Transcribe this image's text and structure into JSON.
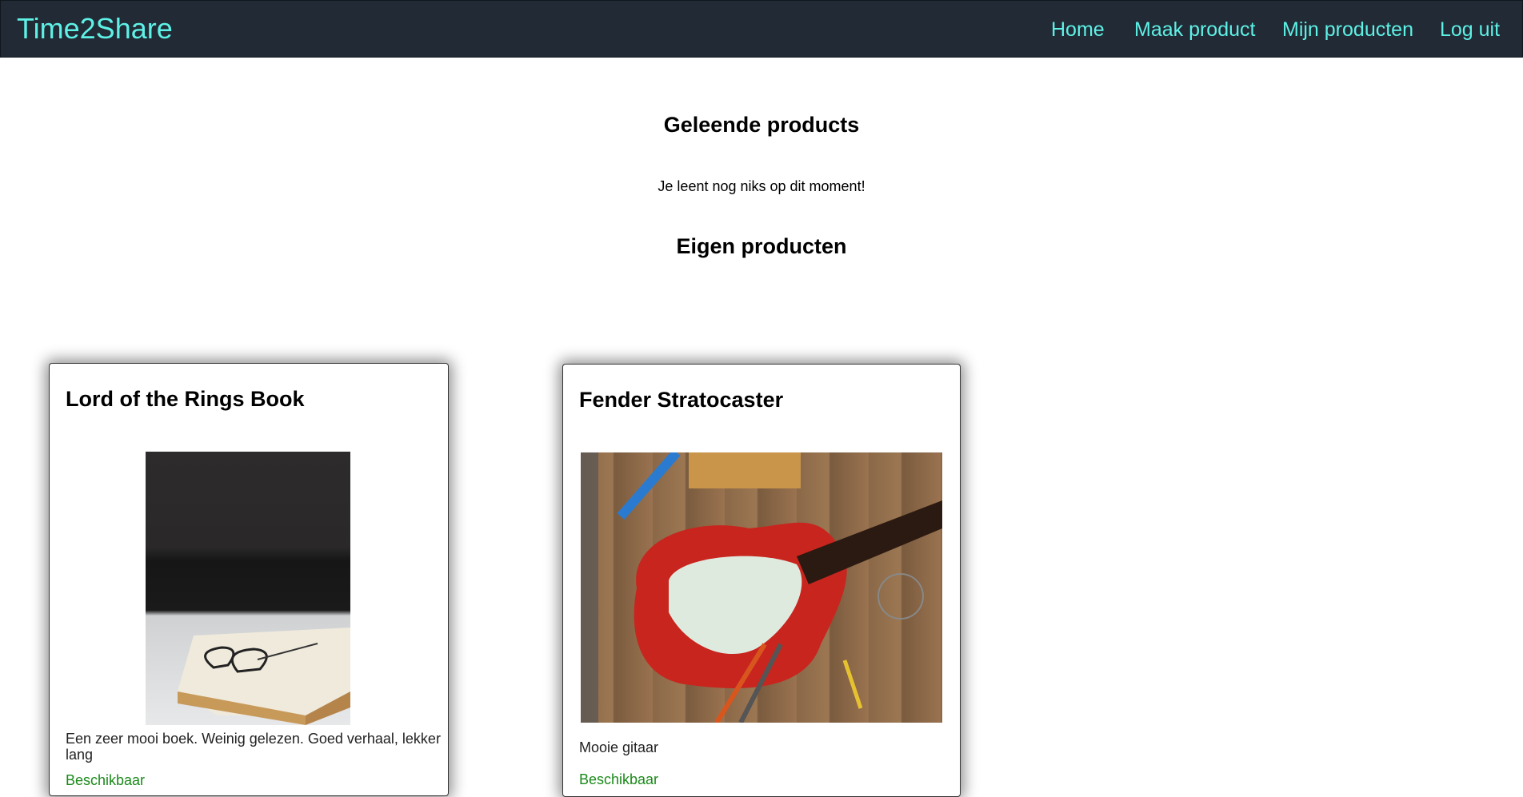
{
  "navbar": {
    "brand": "Time2Share",
    "links": [
      "Home",
      "Maak product",
      "Mijn producten",
      "Log uit"
    ]
  },
  "borrowed": {
    "title": "Geleende products",
    "empty_message": "Je leent nog niks op dit moment!"
  },
  "own": {
    "title": "Eigen producten",
    "products": [
      {
        "name": "Lord of the Rings Book",
        "description": "Een zeer mooi boek. Weinig gelezen. Goed verhaal, lekker lang",
        "status": "Beschikbaar",
        "image": "book-photo"
      },
      {
        "name": "Fender Stratocaster",
        "description": "Mooie gitaar",
        "status": "Beschikbaar",
        "image": "guitar-photo"
      }
    ]
  }
}
